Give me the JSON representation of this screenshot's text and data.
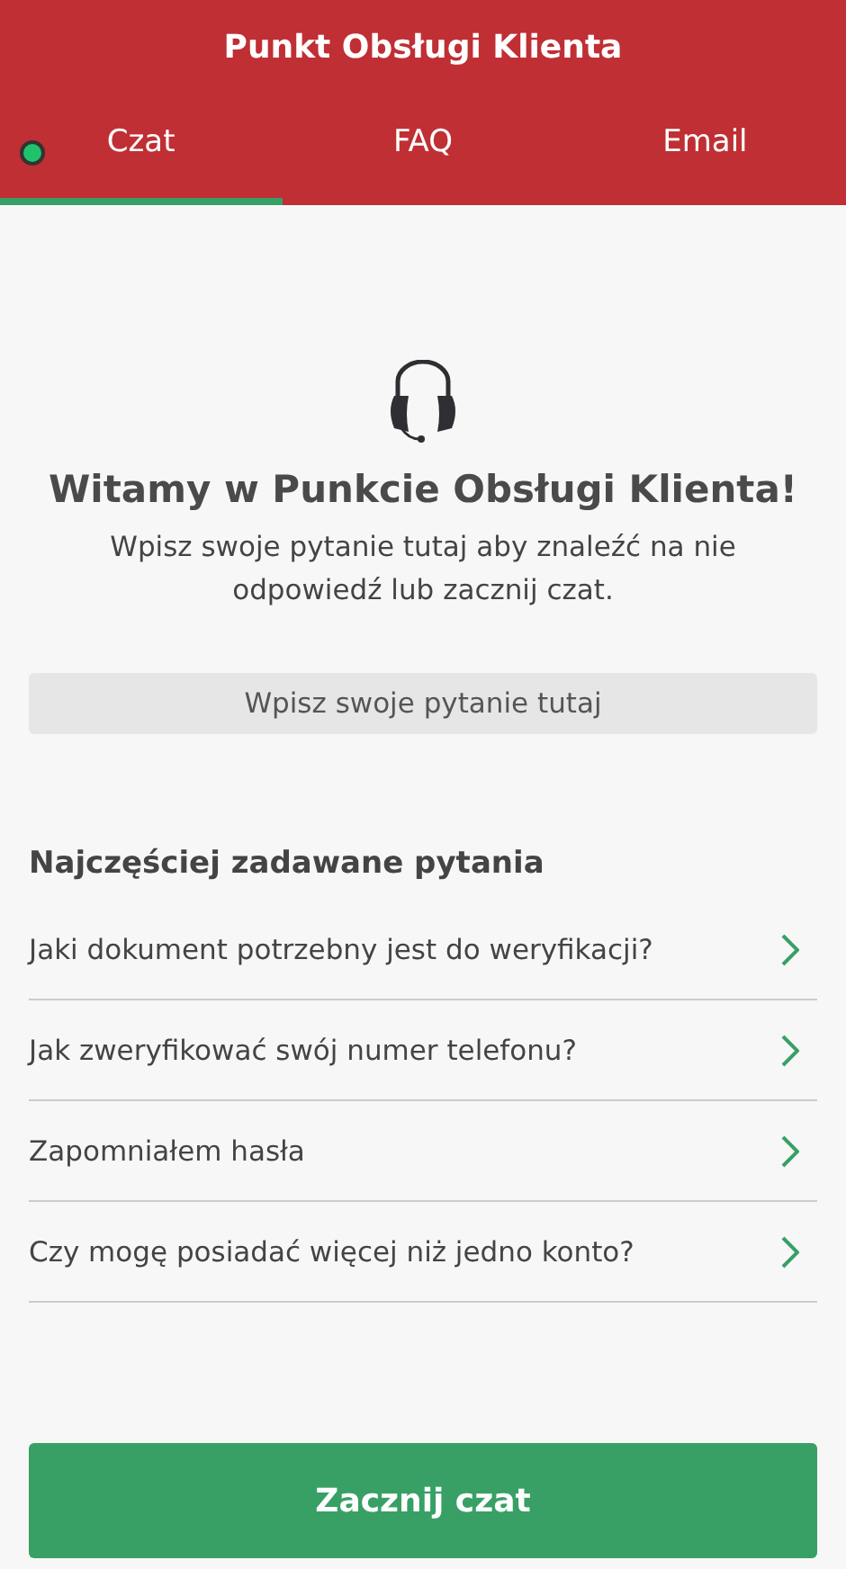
{
  "header": {
    "title": "Punkt Obsługi Klienta"
  },
  "status": {
    "online": true
  },
  "tabs": [
    {
      "label": "Czat",
      "selected": true
    },
    {
      "label": "FAQ",
      "selected": false
    },
    {
      "label": "Email",
      "selected": false
    }
  ],
  "welcome": {
    "title": "Witamy w Punkcie Obsługi Klienta!",
    "subtitle": "Wpisz swoje pytanie tutaj aby znaleźć na nie odpowiedź lub zacznij czat."
  },
  "search": {
    "placeholder": "Wpisz swoje pytanie tutaj"
  },
  "faq": {
    "title": "Najczęściej zadawane pytania",
    "items": [
      "Jaki dokument potrzebny jest do weryfikacji?",
      "Jak zweryfikować swój numer telefonu?",
      "Zapomniałem hasła",
      "Czy mogę posiadać więcej niż jedno konto?"
    ]
  },
  "start_button": {
    "label": "Zacznij czat"
  }
}
